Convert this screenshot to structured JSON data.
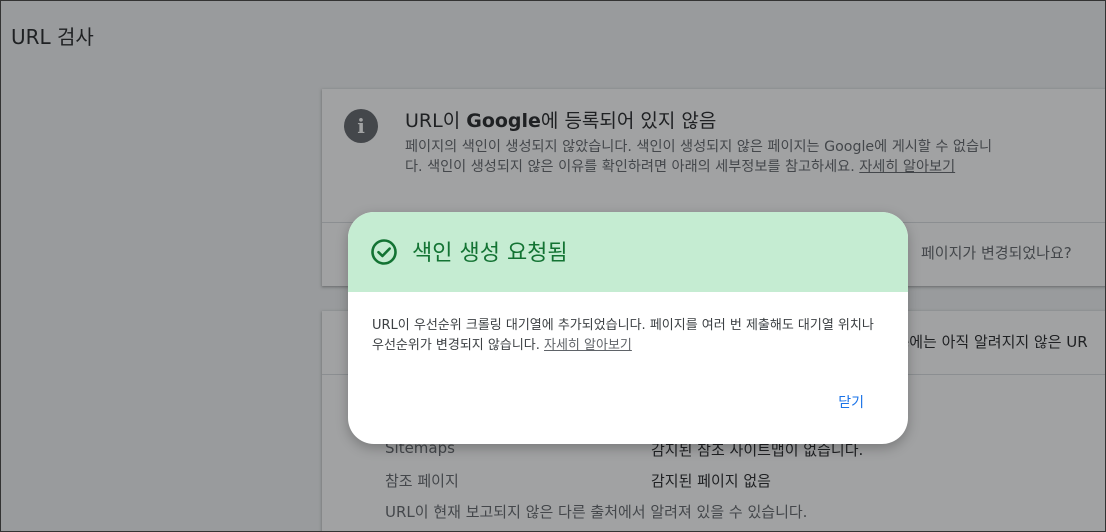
{
  "page": {
    "title": "URL 검사"
  },
  "status_card": {
    "title_prefix": "URL이 ",
    "title_brand": "Google",
    "title_suffix": "에 등록되어 있지 않음",
    "description": "페이지의 색인이 생성되지 않았습니다. 색인이 생성되지 않은 페이지는 Google에 게시할 수 없습니다. 색인이 생성되지 않은 이유를 확인하려면 아래의 세부정보를 참고하세요.",
    "learn_more": "자세히 알아보기",
    "changed_question": "페이지가 변경되었나요?"
  },
  "discovery_card": {
    "heading_fragment": "e에는 아직 알려지지 않은 UR",
    "rows": [
      {
        "label": "Sitemaps",
        "value": "감지된 참조 사이트맵이 없습니다."
      },
      {
        "label": "참조 페이지",
        "value": "감지된 페이지 없음"
      }
    ],
    "note": "URL이 현재 보고되지 않은 다른 출처에서 알려져 있을 수 있습니다."
  },
  "dialog": {
    "title": "색인 생성 요청됨",
    "body": "URL이 우선순위 크롤링 대기열에 추가되었습니다. 페이지를 여러 번 제출해도 대기열 위치나 우선순위가 변경되지 않습니다. ",
    "learn_more": "자세히 알아보기",
    "close_label": "닫기"
  },
  "colors": {
    "dialog_header_bg": "#c5ecd2",
    "success_green": "#137333",
    "link_blue": "#1a73e8"
  },
  "icons": {
    "info": "info-icon",
    "success": "check-circle-icon"
  }
}
